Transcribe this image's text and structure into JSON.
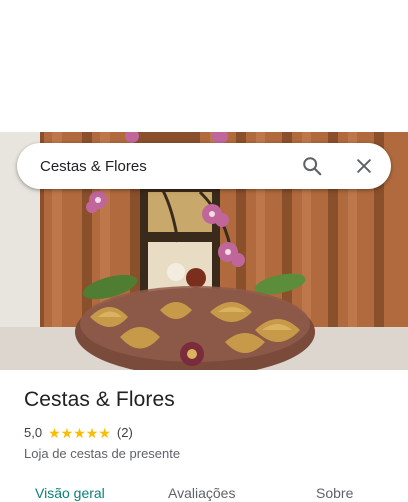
{
  "search": {
    "query": "Cestas & Flores"
  },
  "place": {
    "name": "Cestas & Flores",
    "rating": "5,0",
    "stars": 5,
    "review_count": "(2)",
    "category": "Loja de cestas de presente"
  },
  "tabs": [
    {
      "label": "Visão geral",
      "active": true
    },
    {
      "label": "Avaliações",
      "active": false
    },
    {
      "label": "Sobre",
      "active": false
    }
  ],
  "colors": {
    "accent": "#0b7f7a",
    "star": "#fbbc04",
    "text_primary": "#202124",
    "text_secondary": "#5f6368"
  },
  "icons": {
    "search": "search-icon",
    "close": "close-icon"
  }
}
